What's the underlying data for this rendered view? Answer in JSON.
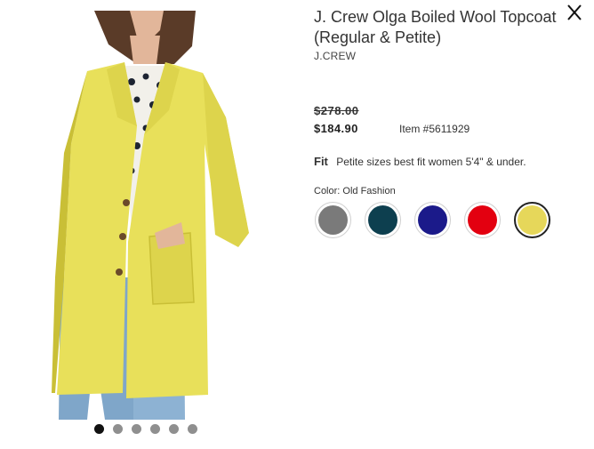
{
  "product": {
    "title": "J. Crew Olga Boiled Wool Topcoat (Regular & Petite)",
    "brand": "J.CREW",
    "original_price": "$278.00",
    "sale_price": "$184.90",
    "item_number": "Item #5611929",
    "fit_label": "Fit",
    "fit_text": "Petite sizes best fit women 5'4\" & under.",
    "color_label": "Color: Old Fashion"
  },
  "close": {
    "label": "X"
  },
  "colors": {
    "coat": "#e8e05a",
    "coat_shadow": "#c9bf36",
    "jeans": "#7fa6c9",
    "blouse": "#f2f0ea"
  },
  "swatches": [
    {
      "name": "gray",
      "color": "#7a7a7a",
      "selected": false
    },
    {
      "name": "dark-teal",
      "color": "#0d3f4f",
      "selected": false
    },
    {
      "name": "navy",
      "color": "#1b1a8a",
      "selected": false
    },
    {
      "name": "red",
      "color": "#e30010",
      "selected": false
    },
    {
      "name": "yellow",
      "color": "#e6d75a",
      "selected": true
    }
  ],
  "gallery": {
    "count": 6,
    "active_index": 0
  }
}
